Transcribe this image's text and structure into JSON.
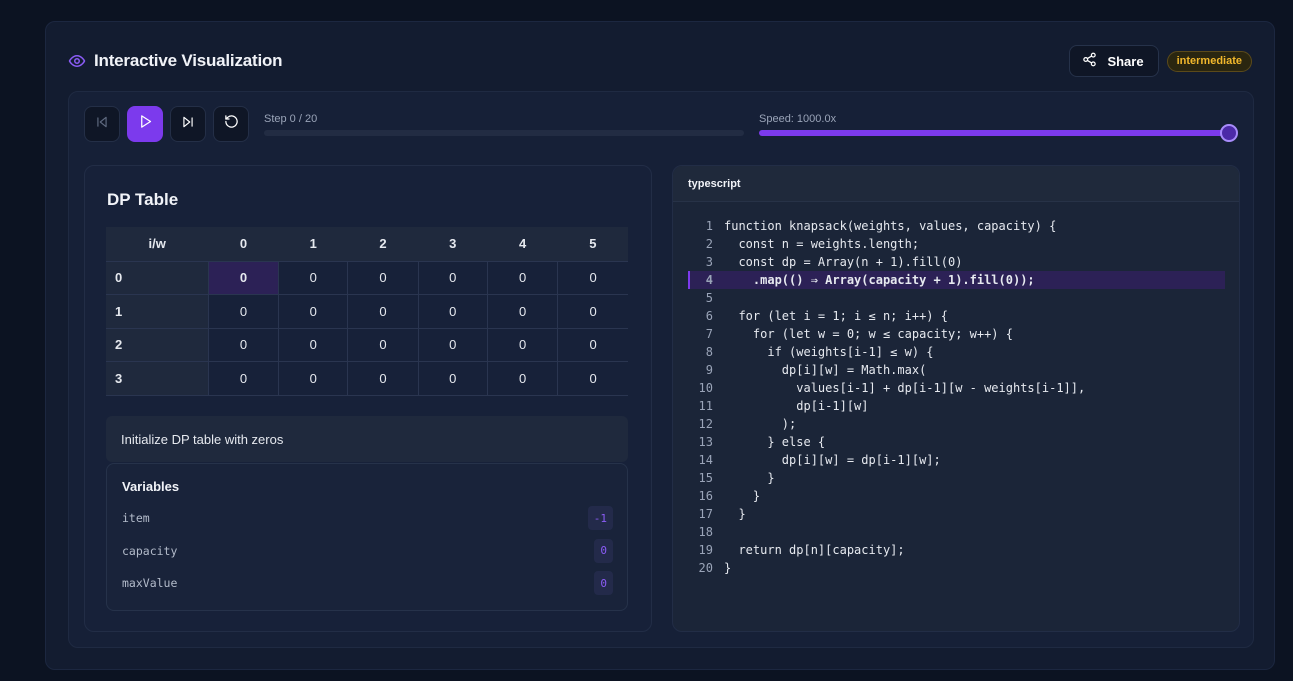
{
  "header": {
    "title": "Interactive Visualization",
    "share_label": "Share",
    "difficulty": "intermediate"
  },
  "controls": {
    "step_label": "Step 0 / 20",
    "step_progress": 0,
    "speed_label": "Speed: 1000.0x",
    "speed_level": 1.0
  },
  "dp": {
    "title": "DP Table",
    "corner": "i/w",
    "columns": [
      "0",
      "1",
      "2",
      "3",
      "4",
      "5"
    ],
    "rows": [
      {
        "label": "0",
        "cells": [
          "0",
          "0",
          "0",
          "0",
          "0",
          "0"
        ]
      },
      {
        "label": "1",
        "cells": [
          "0",
          "0",
          "0",
          "0",
          "0",
          "0"
        ]
      },
      {
        "label": "2",
        "cells": [
          "0",
          "0",
          "0",
          "0",
          "0",
          "0"
        ]
      },
      {
        "label": "3",
        "cells": [
          "0",
          "0",
          "0",
          "0",
          "0",
          "0"
        ]
      }
    ],
    "highlighted_cell": {
      "row": 0,
      "col": 0
    },
    "description": "Initialize DP table with zeros"
  },
  "variables": {
    "title": "Variables",
    "items": [
      {
        "name": "item",
        "value": "-1"
      },
      {
        "name": "capacity",
        "value": "0"
      },
      {
        "name": "maxValue",
        "value": "0"
      }
    ]
  },
  "code": {
    "language": "typescript",
    "active_line": 4,
    "lines": [
      "function knapsack(weights, values, capacity) {",
      "  const n = weights.length;",
      "  const dp = Array(n + 1).fill(0)",
      "    .map(() ⇒ Array(capacity + 1).fill(0));",
      "",
      "  for (let i = 1; i ≤ n; i++) {",
      "    for (let w = 0; w ≤ capacity; w++) {",
      "      if (weights[i-1] ≤ w) {",
      "        dp[i][w] = Math.max(",
      "          values[i-1] + dp[i-1][w - weights[i-1]],",
      "          dp[i-1][w]",
      "        );",
      "      } else {",
      "        dp[i][w] = dp[i-1][w];",
      "      }",
      "    }",
      "  }",
      "",
      "  return dp[n][capacity];",
      "}"
    ]
  },
  "colors": {
    "accent": "#7c3aed",
    "badge": "#f2b82c",
    "background": "#0c1322"
  }
}
